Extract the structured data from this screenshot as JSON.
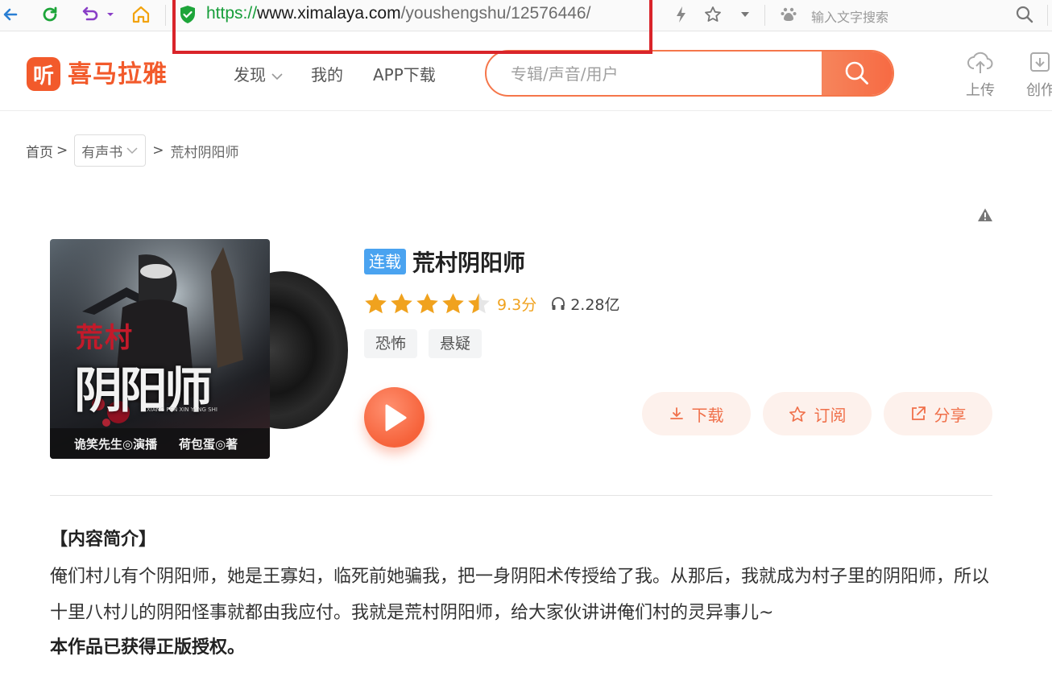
{
  "browser": {
    "url_scheme": "https://",
    "url_host": "www.ximalaya.com",
    "url_path": "/youshengshu/12576446/",
    "search_placeholder": "输入文字搜索"
  },
  "header": {
    "logo_mark": "听",
    "logo_text": "喜马拉雅",
    "nav": [
      {
        "label": "发现"
      },
      {
        "label": "我的"
      },
      {
        "label": "APP下载"
      }
    ],
    "search_placeholder": "专辑/声音/用户",
    "actions": [
      {
        "label": "上传"
      },
      {
        "label": "创作"
      }
    ]
  },
  "breadcrumb": {
    "home": "首页",
    "sep": ">",
    "category": "有声书",
    "current": "荒村阴阳师"
  },
  "album": {
    "badge": "连载",
    "title": "荒村阴阳师",
    "rating_stars": 4.5,
    "score": "9.3分",
    "plays": "2.28亿",
    "tags": [
      "恐怖",
      "悬疑"
    ],
    "actions": {
      "download": "下载",
      "subscribe": "订阅",
      "share": "分享"
    },
    "cover": {
      "title_small": "荒村",
      "title_big": "阴阳师",
      "pinyin": "XIANG FEN XIN YANG SHI",
      "credit_narrator": "诡笑先生◎演播",
      "credit_author": "荷包蛋◎著"
    }
  },
  "intro": {
    "heading": "【内容简介】",
    "body": "俺们村儿有个阴阳师，她是王寡妇，临死前她骗我，把一身阴阳术传授给了我。从那后，我就成为村子里的阴阳师，所以十里八村儿的阴阳怪事就都由我应付。我就是荒村阴阳师，给大家伙讲讲俺们村的灵异事儿~",
    "note": "本作品已获得正版授权。"
  },
  "colors": {
    "brand": "#f25a2b",
    "badge": "#4aa3f0",
    "star": "#f0a21e",
    "highlight": "#d9242a"
  }
}
